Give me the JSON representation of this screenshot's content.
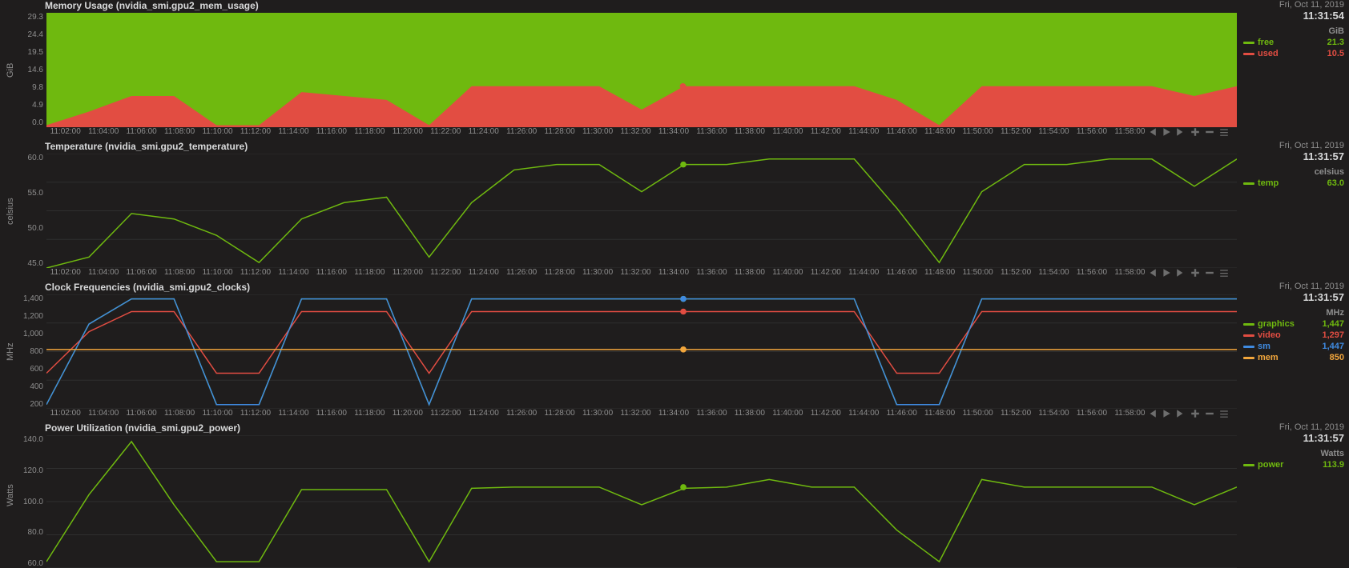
{
  "xticks": [
    "11:02:00",
    "11:04:00",
    "11:06:00",
    "11:08:00",
    "11:10:00",
    "11:12:00",
    "11:14:00",
    "11:16:00",
    "11:18:00",
    "11:20:00",
    "11:22:00",
    "11:24:00",
    "11:26:00",
    "11:28:00",
    "11:30:00",
    "11:32:00",
    "11:34:00",
    "11:36:00",
    "11:38:00",
    "11:40:00",
    "11:42:00",
    "11:44:00",
    "11:46:00",
    "11:48:00",
    "11:50:00",
    "11:52:00",
    "11:54:00",
    "11:56:00",
    "11:58:00"
  ],
  "panels": {
    "mem": {
      "title": "Memory Usage (nvidia_smi.gpu2_mem_usage)",
      "ylabel": "GiB",
      "yticks": [
        "29.3",
        "24.4",
        "19.5",
        "14.6",
        "9.8",
        "4.9",
        "0.0"
      ],
      "timestamp_date": "Fri, Oct 11, 2019",
      "timestamp_time": "11:31:54",
      "unit": "GiB",
      "legend": [
        {
          "name": "free",
          "color": "#6fb90f",
          "value": "21.3"
        },
        {
          "name": "used",
          "color": "#e24d42",
          "value": "10.5"
        }
      ]
    },
    "temp": {
      "title": "Temperature (nvidia_smi.gpu2_temperature)",
      "ylabel": "celsius",
      "yticks": [
        "60.0",
        "55.0",
        "50.0",
        "45.0"
      ],
      "timestamp_date": "Fri, Oct 11, 2019",
      "timestamp_time": "11:31:57",
      "unit": "celsius",
      "legend": [
        {
          "name": "temp",
          "color": "#6fb90f",
          "value": "63.0"
        }
      ]
    },
    "clocks": {
      "title": "Clock Frequencies (nvidia_smi.gpu2_clocks)",
      "ylabel": "MHz",
      "yticks": [
        "1,400",
        "1,200",
        "1,000",
        "800",
        "600",
        "400",
        "200"
      ],
      "timestamp_date": "Fri, Oct 11, 2019",
      "timestamp_time": "11:31:57",
      "unit": "MHz",
      "legend": [
        {
          "name": "graphics",
          "color": "#6fb90f",
          "value": "1,447"
        },
        {
          "name": "video",
          "color": "#e24d42",
          "value": "1,297"
        },
        {
          "name": "sm",
          "color": "#3f8ae0",
          "value": "1,447"
        },
        {
          "name": "mem",
          "color": "#f2a63c",
          "value": "850"
        }
      ]
    },
    "power": {
      "title": "Power Utilization (nvidia_smi.gpu2_power)",
      "ylabel": "Watts",
      "yticks": [
        "140.0",
        "120.0",
        "100.0",
        "80.0",
        "60.0"
      ],
      "timestamp_date": "Fri, Oct 11, 2019",
      "timestamp_time": "11:31:57",
      "unit": "Watts",
      "legend": [
        {
          "name": "power",
          "color": "#6fb90f",
          "value": "113.9"
        }
      ]
    }
  },
  "chart_data": [
    {
      "id": "mem",
      "type": "area",
      "title": "Memory Usage (nvidia_smi.gpu2_mem_usage)",
      "xlabel": "",
      "ylabel": "GiB",
      "ylim": [
        0,
        29.3
      ],
      "x": [
        "11:02:00",
        "11:04:00",
        "11:06:00",
        "11:08:00",
        "11:10:00",
        "11:12:00",
        "11:14:00",
        "11:16:00",
        "11:18:00",
        "11:20:00",
        "11:22:00",
        "11:24:00",
        "11:26:00",
        "11:28:00",
        "11:30:00",
        "11:32:00",
        "11:34:00",
        "11:36:00",
        "11:38:00",
        "11:40:00",
        "11:42:00",
        "11:44:00",
        "11:46:00",
        "11:48:00",
        "11:50:00",
        "11:52:00",
        "11:54:00",
        "11:56:00",
        "11:58:00"
      ],
      "series": [
        {
          "name": "used",
          "color": "#e24d42",
          "values": [
            0.5,
            4.0,
            8.0,
            8.0,
            0.5,
            0.5,
            9.0,
            8.0,
            7.0,
            0.5,
            10.5,
            10.5,
            10.5,
            10.5,
            4.5,
            10.5,
            10.5,
            10.5,
            10.5,
            10.5,
            7.0,
            0.5,
            10.5,
            10.5,
            10.5,
            10.5,
            10.5,
            8.0,
            10.5
          ]
        },
        {
          "name": "free",
          "color": "#6fb90f",
          "values": [
            31.3,
            27.8,
            23.8,
            23.8,
            31.3,
            31.3,
            22.8,
            23.8,
            24.8,
            31.3,
            21.3,
            21.3,
            21.3,
            21.3,
            27.3,
            21.3,
            21.3,
            21.3,
            21.3,
            21.3,
            24.8,
            31.3,
            21.3,
            21.3,
            21.3,
            21.3,
            21.3,
            23.8,
            21.3
          ]
        }
      ],
      "stacked": true,
      "total": 31.8,
      "cursor": {
        "time": "11:31:54",
        "values": {
          "free": 21.3,
          "used": 10.5
        }
      }
    },
    {
      "id": "temp",
      "type": "line",
      "title": "Temperature (nvidia_smi.gpu2_temperature)",
      "xlabel": "",
      "ylabel": "celsius",
      "ylim": [
        44,
        65
      ],
      "x": [
        "11:02:00",
        "11:04:00",
        "11:06:00",
        "11:08:00",
        "11:10:00",
        "11:12:00",
        "11:14:00",
        "11:16:00",
        "11:18:00",
        "11:20:00",
        "11:22:00",
        "11:24:00",
        "11:26:00",
        "11:28:00",
        "11:30:00",
        "11:32:00",
        "11:34:00",
        "11:36:00",
        "11:38:00",
        "11:40:00",
        "11:42:00",
        "11:44:00",
        "11:46:00",
        "11:48:00",
        "11:50:00",
        "11:52:00",
        "11:54:00",
        "11:56:00",
        "11:58:00"
      ],
      "series": [
        {
          "name": "temp",
          "color": "#6fb90f",
          "values": [
            44,
            46,
            54,
            53,
            50,
            45,
            53,
            56,
            57,
            46,
            56,
            62,
            63,
            63,
            58,
            63,
            63,
            64,
            64,
            64,
            55,
            45,
            58,
            63,
            63,
            64,
            64,
            59,
            64
          ]
        }
      ],
      "cursor": {
        "time": "11:31:57",
        "values": {
          "temp": 63.0
        }
      }
    },
    {
      "id": "clocks",
      "type": "line",
      "title": "Clock Frequencies (nvidia_smi.gpu2_clocks)",
      "xlabel": "",
      "ylabel": "MHz",
      "ylim": [
        150,
        1500
      ],
      "x": [
        "11:02:00",
        "11:04:00",
        "11:06:00",
        "11:08:00",
        "11:10:00",
        "11:12:00",
        "11:14:00",
        "11:16:00",
        "11:18:00",
        "11:20:00",
        "11:22:00",
        "11:24:00",
        "11:26:00",
        "11:28:00",
        "11:30:00",
        "11:32:00",
        "11:34:00",
        "11:36:00",
        "11:38:00",
        "11:40:00",
        "11:42:00",
        "11:44:00",
        "11:46:00",
        "11:48:00",
        "11:50:00",
        "11:52:00",
        "11:54:00",
        "11:56:00",
        "11:58:00"
      ],
      "series": [
        {
          "name": "graphics",
          "color": "#6fb90f",
          "values": [
            200,
            1150,
            1447,
            1447,
            200,
            200,
            1447,
            1447,
            1447,
            200,
            1447,
            1447,
            1447,
            1447,
            1447,
            1447,
            1447,
            1447,
            1447,
            1447,
            200,
            200,
            1447,
            1447,
            1447,
            1447,
            1447,
            1447,
            1447
          ]
        },
        {
          "name": "video",
          "color": "#e24d42",
          "values": [
            570,
            1060,
            1297,
            1297,
            570,
            570,
            1297,
            1297,
            1297,
            570,
            1297,
            1297,
            1297,
            1297,
            1297,
            1297,
            1297,
            1297,
            1297,
            1297,
            570,
            570,
            1297,
            1297,
            1297,
            1297,
            1297,
            1297,
            1297
          ]
        },
        {
          "name": "sm",
          "color": "#3f8ae0",
          "values": [
            200,
            1150,
            1447,
            1447,
            200,
            200,
            1447,
            1447,
            1447,
            200,
            1447,
            1447,
            1447,
            1447,
            1447,
            1447,
            1447,
            1447,
            1447,
            1447,
            200,
            200,
            1447,
            1447,
            1447,
            1447,
            1447,
            1447,
            1447
          ]
        },
        {
          "name": "mem",
          "color": "#f2a63c",
          "values": [
            850,
            850,
            850,
            850,
            850,
            850,
            850,
            850,
            850,
            850,
            850,
            850,
            850,
            850,
            850,
            850,
            850,
            850,
            850,
            850,
            850,
            850,
            850,
            850,
            850,
            850,
            850,
            850,
            850
          ]
        }
      ],
      "cursor": {
        "time": "11:31:57",
        "values": {
          "graphics": 1447,
          "video": 1297,
          "sm": 1447,
          "mem": 850
        }
      }
    },
    {
      "id": "power",
      "type": "line",
      "title": "Power Utilization (nvidia_smi.gpu2_power)",
      "xlabel": "",
      "ylabel": "Watts",
      "ylim": [
        50,
        155
      ],
      "x": [
        "11:02:00",
        "11:04:00",
        "11:06:00",
        "11:08:00",
        "11:10:00",
        "11:12:00",
        "11:14:00",
        "11:16:00",
        "11:18:00",
        "11:20:00",
        "11:22:00",
        "11:24:00",
        "11:26:00",
        "11:28:00",
        "11:30:00",
        "11:32:00",
        "11:34:00",
        "11:36:00",
        "11:38:00",
        "11:40:00",
        "11:42:00",
        "11:44:00",
        "11:46:00",
        "11:48:00",
        "11:50:00",
        "11:52:00",
        "11:54:00",
        "11:56:00",
        "11:58:00"
      ],
      "series": [
        {
          "name": "power",
          "color": "#6fb90f",
          "values": [
            55,
            108,
            150,
            100,
            55,
            55,
            112,
            112,
            112,
            55,
            113,
            114,
            114,
            114,
            100,
            113,
            114,
            120,
            114,
            114,
            80,
            55,
            120,
            114,
            114,
            114,
            114,
            100,
            114
          ]
        }
      ],
      "cursor": {
        "time": "11:31:57",
        "values": {
          "power": 113.9
        }
      }
    }
  ]
}
